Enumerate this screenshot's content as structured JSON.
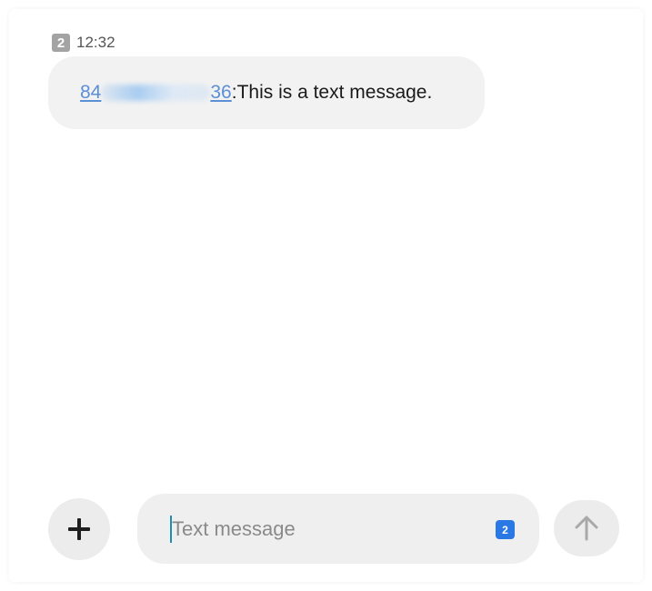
{
  "message": {
    "sim_slot": "2",
    "time": "12:32",
    "sender_prefix": "84",
    "sender_suffix": "36",
    "separator": ":",
    "body": "This is a text message."
  },
  "composer": {
    "placeholder": "Text message",
    "value": "",
    "sim_slot": "2"
  },
  "icons": {
    "attach": "plus-icon",
    "send": "arrow-up-icon",
    "sim": "sim-2-icon"
  },
  "colors": {
    "link": "#5b8fd6",
    "sim_accent": "#2a78e4",
    "bubble": "#f2f2f2",
    "caret": "#1f8fb0"
  }
}
